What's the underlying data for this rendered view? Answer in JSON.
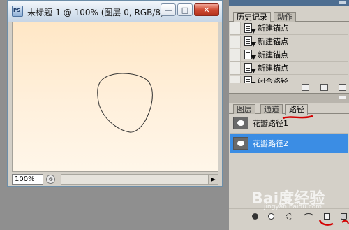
{
  "document": {
    "title": "未标题-1 @ 100% (图层 0, RGB/8)",
    "zoom": "100%"
  },
  "window_buttons": {
    "minimize": "—",
    "maximize": "□",
    "close": "✕"
  },
  "history_panel": {
    "tabs": [
      {
        "label": "历史记录",
        "active": true
      },
      {
        "label": "动作",
        "active": false
      }
    ],
    "items": [
      {
        "label": "新建锚点",
        "icon": "pen-history-icon"
      },
      {
        "label": "新建锚点",
        "icon": "pen-history-icon"
      },
      {
        "label": "新建锚点",
        "icon": "pen-history-icon"
      },
      {
        "label": "新建锚点",
        "icon": "pen-history-icon"
      },
      {
        "label": "闭合路径",
        "icon": "pen-history-icon"
      }
    ]
  },
  "paths_panel": {
    "tabs": [
      {
        "label": "图层",
        "active": false
      },
      {
        "label": "通道",
        "active": false
      },
      {
        "label": "路径",
        "active": true
      }
    ],
    "items": [
      {
        "label": "花瓣路径1",
        "selected": false
      },
      {
        "label": "花瓣路径2",
        "selected": true
      }
    ]
  },
  "watermark": {
    "text": "Bai度经验",
    "sub": "jingyan.baidu.com"
  },
  "colors": {
    "selection": "#3b8de4",
    "annotation_red": "#d40000",
    "canvas_top": "#ffe7c6",
    "panel_bg": "#d4d0c8"
  }
}
